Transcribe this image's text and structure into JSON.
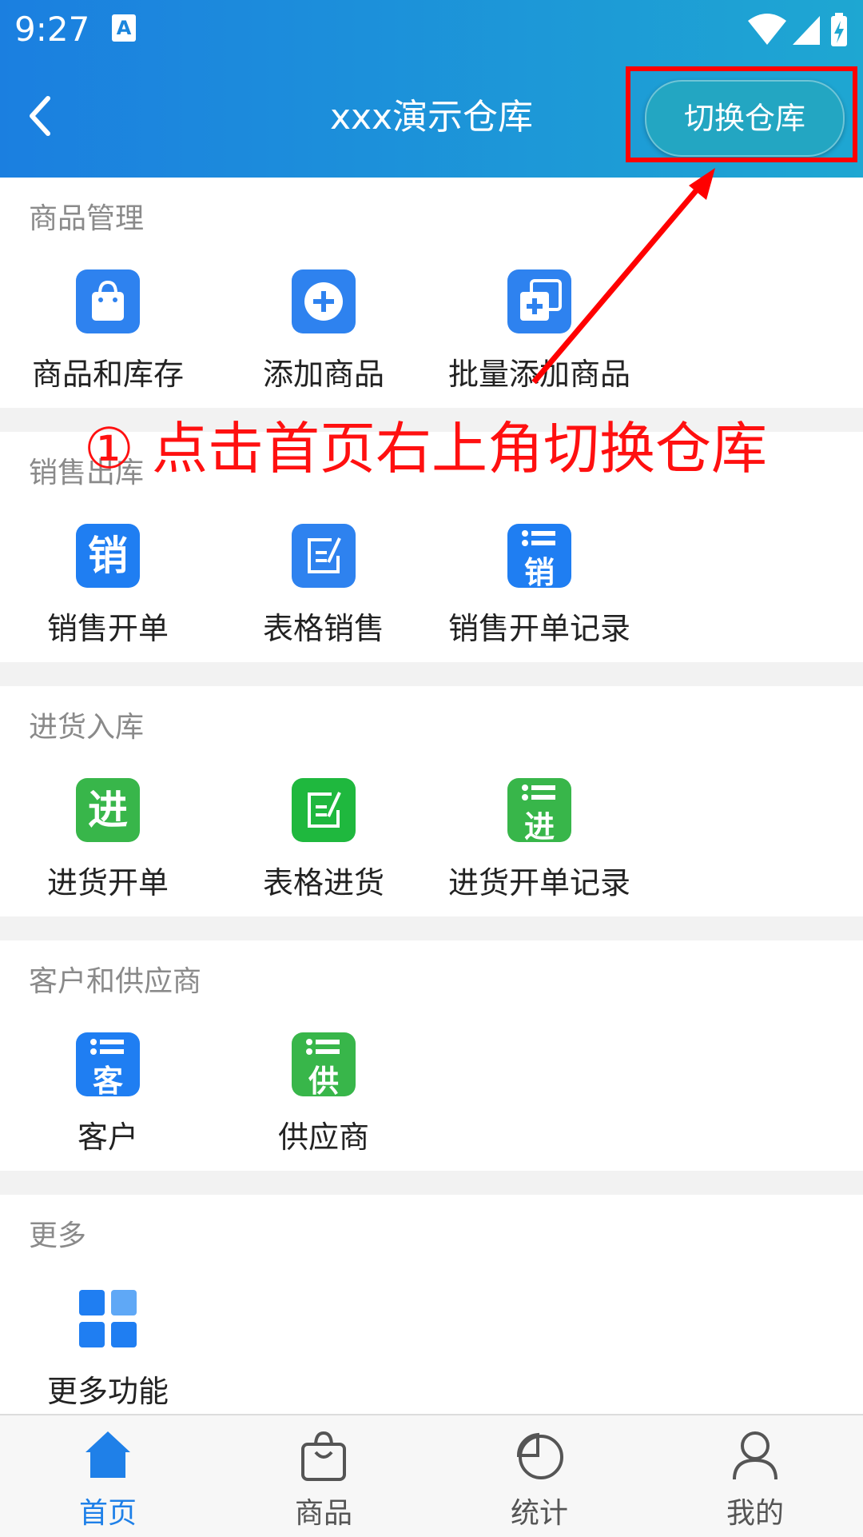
{
  "status_bar": {
    "time": "9:27",
    "app_icon_letter": "A"
  },
  "header": {
    "title": "xxx演示仓库",
    "switch_button": "切换仓库"
  },
  "annotation": {
    "text": "① 点击首页右上角切换仓库"
  },
  "colors": {
    "blue": "#1f7ef2",
    "green": "#2fb34a",
    "annotation_red": "#ff0000",
    "tab_active": "#1f80e8"
  },
  "sections": [
    {
      "title": "商品管理",
      "items": [
        {
          "label": "商品和库存",
          "icon": "shopping-bag-icon"
        },
        {
          "label": "添加商品",
          "icon": "plus-circle-icon"
        },
        {
          "label": "批量添加商品",
          "icon": "batch-add-icon"
        }
      ]
    },
    {
      "title": "销售出库",
      "items": [
        {
          "label": "销售开单",
          "icon": "sale-char-icon",
          "glyph": "销"
        },
        {
          "label": "表格销售",
          "icon": "edit-form-icon"
        },
        {
          "label": "销售开单记录",
          "icon": "sale-record-icon",
          "glyph": "销"
        }
      ]
    },
    {
      "title": "进货入库",
      "items": [
        {
          "label": "进货开单",
          "icon": "purchase-char-icon",
          "glyph": "进"
        },
        {
          "label": "表格进货",
          "icon": "edit-form-icon"
        },
        {
          "label": "进货开单记录",
          "icon": "purchase-record-icon",
          "glyph": "进"
        }
      ]
    },
    {
      "title": "客户和供应商",
      "items": [
        {
          "label": "客户",
          "icon": "customer-icon",
          "glyph": "客"
        },
        {
          "label": "供应商",
          "icon": "supplier-icon",
          "glyph": "供"
        }
      ]
    },
    {
      "title": "更多",
      "items": [
        {
          "label": "更多功能",
          "icon": "grid-icon"
        }
      ]
    }
  ],
  "tabbar": [
    {
      "label": "首页",
      "icon": "home-icon",
      "active": true
    },
    {
      "label": "商品",
      "icon": "bag-icon",
      "active": false
    },
    {
      "label": "统计",
      "icon": "pie-chart-icon",
      "active": false
    },
    {
      "label": "我的",
      "icon": "user-icon",
      "active": false
    }
  ]
}
